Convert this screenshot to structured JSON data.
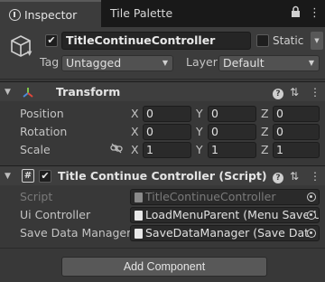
{
  "tabs": [
    {
      "label": "Inspector"
    },
    {
      "label": "Tile Palette"
    }
  ],
  "header": {
    "active": true,
    "object_name": "TitleContinueController",
    "static_label": "Static",
    "static": false,
    "tag_label": "Tag",
    "tag_value": "Untagged",
    "layer_label": "Layer",
    "layer_value": "Default"
  },
  "transform": {
    "title": "Transform",
    "rows": [
      {
        "label": "Position",
        "x": "0",
        "y": "0",
        "z": "0"
      },
      {
        "label": "Rotation",
        "x": "0",
        "y": "0",
        "z": "0"
      },
      {
        "label": "Scale",
        "x": "1",
        "y": "1",
        "z": "1"
      }
    ],
    "axis": {
      "x": "X",
      "y": "Y",
      "z": "Z"
    }
  },
  "script_component": {
    "title": "Title Continue Controller (Script)",
    "enabled": true,
    "fields": [
      {
        "label": "Script",
        "value": "TitleContinueController",
        "disabled": true
      },
      {
        "label": "Ui Controller",
        "value": "LoadMenuParent (Menu Save U"
      },
      {
        "label": "Save Data Manager",
        "value": "SaveDataManager (Save Data M"
      }
    ]
  },
  "add_component_label": "Add Component",
  "colors": {
    "background": "#383838",
    "tabbar": "#191919",
    "field": "#2a2a2a",
    "button": "#585858"
  },
  "icons": [
    "info-icon",
    "lock-icon",
    "kebab-menu-icon",
    "gameobject-cube-icon",
    "transform-axes-icon",
    "help-icon",
    "preset-icon",
    "script-icon",
    "constrain-link-icon",
    "object-picker-icon"
  ]
}
